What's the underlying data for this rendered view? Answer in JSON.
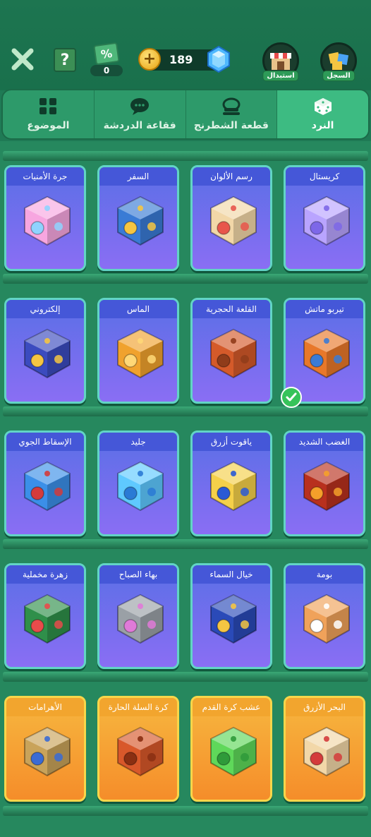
{
  "topbar": {
    "coupon_symbol": "%",
    "coupon_count": "0",
    "coins_plus": "+",
    "coins": "189",
    "help_symbol": "?",
    "shop_label": "استبدال",
    "history_label": "السجل"
  },
  "tabs": [
    {
      "label": "الموضوع",
      "icon": "grid-icon"
    },
    {
      "label": "فقاعة الدردشة",
      "icon": "chat-bubble-icon"
    },
    {
      "label": "قطعة الشطرنج",
      "icon": "chess-piece-icon"
    },
    {
      "label": "النرد",
      "icon": "dice-icon",
      "active": true
    }
  ],
  "rows": [
    [
      {
        "title": "جرة الأمنيات",
        "theme": "purple",
        "icon": "wish-jar-dice-icon"
      },
      {
        "title": "السفر",
        "theme": "purple",
        "icon": "bus-dice-icon"
      },
      {
        "title": "رسم الألوان",
        "theme": "purple",
        "icon": "paint-dice-icon"
      },
      {
        "title": "كريستال",
        "theme": "purple",
        "icon": "crystal-dice-icon"
      }
    ],
    [
      {
        "title": "إلكتروني",
        "theme": "purple",
        "icon": "electronic-dice-icon"
      },
      {
        "title": "الماس",
        "theme": "purple",
        "icon": "diamond-dice-icon"
      },
      {
        "title": "القلعة الحجرية",
        "theme": "purple",
        "icon": "stone-castle-dice-icon"
      },
      {
        "title": "تيربو ماتش",
        "theme": "purple",
        "icon": "turbo-match-dice-icon",
        "selected": true
      }
    ],
    [
      {
        "title": "الإسقاط الجوي",
        "theme": "purple",
        "icon": "airdrop-dice-icon"
      },
      {
        "title": "جليد",
        "theme": "purple",
        "icon": "ice-dice-icon"
      },
      {
        "title": "ياقوت أزرق",
        "theme": "purple",
        "icon": "sapphire-dice-icon"
      },
      {
        "title": "الغضب الشديد",
        "theme": "purple",
        "icon": "lava-dice-icon"
      }
    ],
    [
      {
        "title": "زهرة مخملية",
        "theme": "purple",
        "icon": "velvet-flower-dice-icon"
      },
      {
        "title": "بهاء الصباح",
        "theme": "purple",
        "icon": "morning-glory-dice-icon"
      },
      {
        "title": "خيال السماء",
        "theme": "purple",
        "icon": "sky-fantasy-dice-icon"
      },
      {
        "title": "بومة",
        "theme": "purple",
        "icon": "owl-dice-icon"
      }
    ],
    [
      {
        "title": "الأهرامات",
        "theme": "orange",
        "icon": "pyramid-dice-icon"
      },
      {
        "title": "كرة السلة الحارة",
        "theme": "orange",
        "icon": "basketball-dice-icon"
      },
      {
        "title": "عشب كرة القدم",
        "theme": "orange",
        "icon": "football-dice-icon"
      },
      {
        "title": "البحر الأزرق",
        "theme": "orange",
        "icon": "blue-sea-dice-icon"
      }
    ]
  ],
  "colors": {
    "background": "#1f7a55",
    "active_tab": "#3dbb82",
    "card_purple": "#5a6fe6",
    "card_orange": "#f7b73f",
    "check": "#36c35a"
  }
}
